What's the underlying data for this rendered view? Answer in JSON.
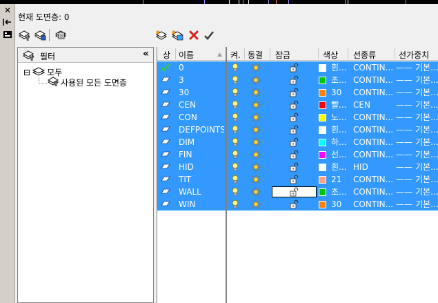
{
  "header": {
    "current_layer_label": "현재 도면층: 0"
  },
  "filters": {
    "title": "필터",
    "collapse_glyph": "«",
    "tree": [
      {
        "label": "모두",
        "expander": "⊟"
      },
      {
        "label": "사용된 모든 도면층"
      }
    ]
  },
  "columns": [
    "상",
    "이름",
    "켜.",
    "동결",
    "잠금",
    "색상",
    "선종류",
    "선가중치"
  ],
  "layers": [
    {
      "name": "0",
      "color_name": "흰...",
      "color": "#ffffff",
      "linetype": "CONTIN...",
      "lineweight": "기본...",
      "current": true
    },
    {
      "name": "3",
      "color_name": "초...",
      "color": "#00c800",
      "linetype": "CONTIN...",
      "lineweight": "기본..."
    },
    {
      "name": "30",
      "color_name": "30",
      "color": "#ff7f00",
      "linetype": "CONTIN...",
      "lineweight": "기본..."
    },
    {
      "name": "CEN",
      "color_name": "빨...",
      "color": "#ff0000",
      "linetype": "CEN",
      "lineweight": "기본..."
    },
    {
      "name": "CON",
      "color_name": "노...",
      "color": "#ffff00",
      "linetype": "CONTIN...",
      "lineweight": "기본..."
    },
    {
      "name": "DEFPOINTS",
      "color_name": "흰...",
      "color": "#ffffff",
      "linetype": "CONTIN...",
      "lineweight": "기본..."
    },
    {
      "name": "DIM",
      "color_name": "하...",
      "color": "#00ffff",
      "linetype": "CONTIN...",
      "lineweight": "기본..."
    },
    {
      "name": "FIN",
      "color_name": "선...",
      "color": "#ff00ff",
      "linetype": "CONTIN...",
      "lineweight": "기본..."
    },
    {
      "name": "HID",
      "color_name": "흰...",
      "color": "#ffffff",
      "linetype": "HID",
      "lineweight": "기본..."
    },
    {
      "name": "TIT",
      "color_name": "21",
      "color": "#ff9f7f",
      "linetype": "CONTIN...",
      "lineweight": "기본..."
    },
    {
      "name": "WALL",
      "color_name": "초...",
      "color": "#00c800",
      "linetype": "CONTIN...",
      "lineweight": "기본..."
    },
    {
      "name": "WIN",
      "color_name": "30",
      "color": "#ff7f00",
      "linetype": "CONTIN...",
      "lineweight": "기본..."
    }
  ],
  "lineweight_dash": "——",
  "icons": {
    "sidebar": [
      "close-icon",
      "autohide-icon",
      "properties-icon"
    ],
    "toolbar": [
      "new-property-filter-icon",
      "new-group-filter-icon",
      "layer-states-manager-icon",
      "new-layer-icon",
      "new-layer-vp-frozen-icon",
      "delete-layer-icon",
      "set-current-icon"
    ],
    "row": [
      "layer-status-icon",
      "lightbulb-on-icon",
      "sun-thawed-icon",
      "padlock-unlocked-icon"
    ]
  },
  "accent_colors": {
    "selection": "#3399ff",
    "panel": "#f0f0f0"
  }
}
